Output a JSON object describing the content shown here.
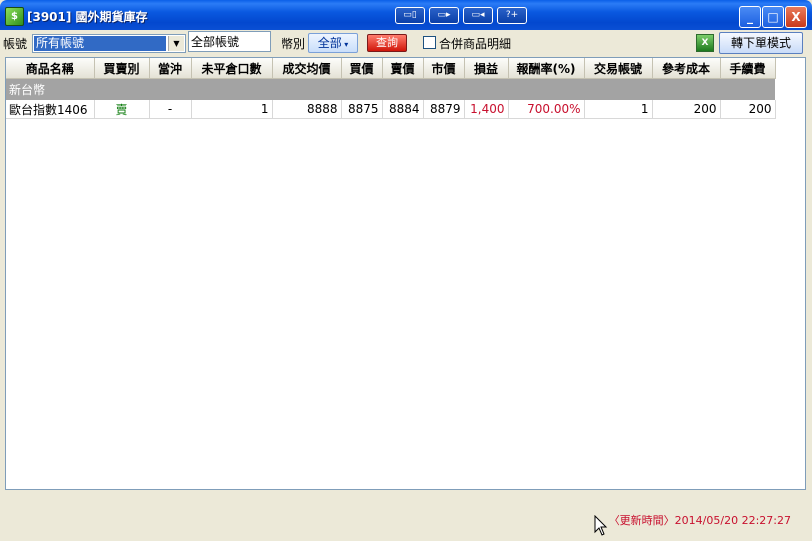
{
  "window": {
    "title": "[3901] 國外期貨庫存",
    "app_icon_label": "$",
    "toolbar_icons": [
      "layout-icon",
      "window-icon",
      "screen-icon",
      "help-icon"
    ],
    "min_label": "_",
    "max_label": "□",
    "close_label": "X"
  },
  "toolbar": {
    "account_label": "帳號",
    "account_select_value": "所有帳號",
    "account_text_value": "全部帳號",
    "currency_label": "幣別",
    "currency_button_label": "全部",
    "query_button_label": "查詢",
    "merge_checkbox_label": "合併商品明細",
    "merge_checked": false,
    "export_excel_icon": "excel-icon",
    "order_mode_button_label": "轉下單模式"
  },
  "table": {
    "columns": [
      "商品名稱",
      "買賣別",
      "當沖",
      "未平倉口數",
      "成交均價",
      "買價",
      "賣價",
      "市價",
      "損益",
      "報酬率(%)",
      "交易帳號",
      "參考成本",
      "手續費"
    ],
    "groups": [
      {
        "name": "新台幣",
        "rows": [
          {
            "product": "歐台指數1406",
            "side": "賣",
            "day_trade": "-",
            "open_qty": "1",
            "avg_price": "8888",
            "bid": "8875",
            "ask": "8884",
            "market": "8879",
            "pnl": "1,400",
            "return_pct": "700.00%",
            "account": "1",
            "ref_cost": "200",
            "fee": "200"
          }
        ]
      }
    ]
  },
  "status": {
    "update_time": "〈更新時間〉2014/05/20 22:27:27"
  },
  "colors": {
    "titlebar": "#0a59e0",
    "sell": "#0a7a0a",
    "profit": "#c8102e",
    "group_header": "#a3a3a3"
  }
}
